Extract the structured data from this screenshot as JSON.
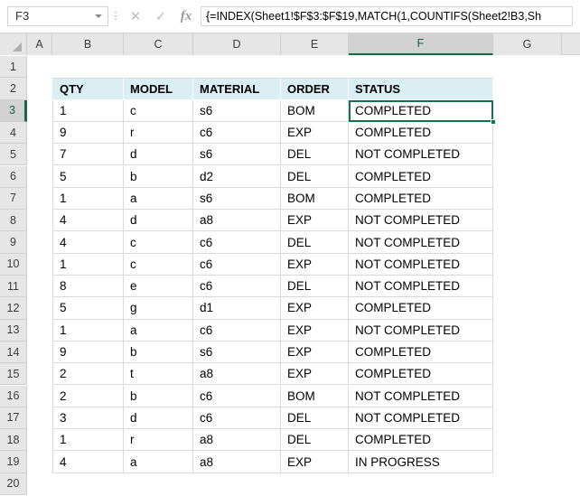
{
  "formula_bar": {
    "name_box_value": "F3",
    "cancel_icon": "close-icon",
    "confirm_icon": "check-icon",
    "function_icon": "fx-icon",
    "formula_value": "{=INDEX(Sheet1!$F$3:$F$19,MATCH(1,COUNTIFS(Sheet2!B3,Sh"
  },
  "grid": {
    "column_headers": [
      "A",
      "B",
      "C",
      "D",
      "E",
      "F",
      "G"
    ],
    "selected_column": "F",
    "row_headers": [
      "1",
      "2",
      "3",
      "4",
      "5",
      "6",
      "7",
      "8",
      "9",
      "10",
      "11",
      "12",
      "13",
      "14",
      "15",
      "16",
      "17",
      "18",
      "19",
      "20"
    ],
    "selected_row": "3",
    "selected_cell": "F3",
    "table_headers": [
      "QTY",
      "MODEL",
      "MATERIAL",
      "ORDER",
      "STATUS"
    ],
    "rows": [
      {
        "qty": "1",
        "model": "c",
        "material": "s6",
        "order": "BOM",
        "status": "COMPLETED"
      },
      {
        "qty": "9",
        "model": "r",
        "material": "c6",
        "order": "EXP",
        "status": "COMPLETED"
      },
      {
        "qty": "7",
        "model": "d",
        "material": "s6",
        "order": "DEL",
        "status": "NOT COMPLETED"
      },
      {
        "qty": "5",
        "model": "b",
        "material": "d2",
        "order": "DEL",
        "status": "COMPLETED"
      },
      {
        "qty": "1",
        "model": "a",
        "material": "s6",
        "order": "BOM",
        "status": "COMPLETED"
      },
      {
        "qty": "4",
        "model": "d",
        "material": "a8",
        "order": "EXP",
        "status": "NOT COMPLETED"
      },
      {
        "qty": "4",
        "model": "c",
        "material": "c6",
        "order": "DEL",
        "status": "NOT COMPLETED"
      },
      {
        "qty": "1",
        "model": "c",
        "material": "c6",
        "order": "EXP",
        "status": "NOT COMPLETED"
      },
      {
        "qty": "8",
        "model": "e",
        "material": "c6",
        "order": "DEL",
        "status": "NOT COMPLETED"
      },
      {
        "qty": "5",
        "model": "g",
        "material": "d1",
        "order": "EXP",
        "status": "COMPLETED"
      },
      {
        "qty": "1",
        "model": "a",
        "material": "c6",
        "order": "EXP",
        "status": "NOT COMPLETED"
      },
      {
        "qty": "9",
        "model": "b",
        "material": "s6",
        "order": "EXP",
        "status": "COMPLETED"
      },
      {
        "qty": "2",
        "model": "t",
        "material": "a8",
        "order": "EXP",
        "status": "COMPLETED"
      },
      {
        "qty": "2",
        "model": "b",
        "material": "c6",
        "order": "BOM",
        "status": "NOT COMPLETED"
      },
      {
        "qty": "3",
        "model": "d",
        "material": "c6",
        "order": "DEL",
        "status": "NOT COMPLETED"
      },
      {
        "qty": "1",
        "model": "r",
        "material": "a8",
        "order": "DEL",
        "status": "COMPLETED"
      },
      {
        "qty": "4",
        "model": "a",
        "material": "a8",
        "order": "EXP",
        "status": "IN PROGRESS"
      }
    ]
  },
  "colors": {
    "header_fill": "#daeef3",
    "selection_green": "#157347",
    "header_strip": "#e6e6e6"
  }
}
